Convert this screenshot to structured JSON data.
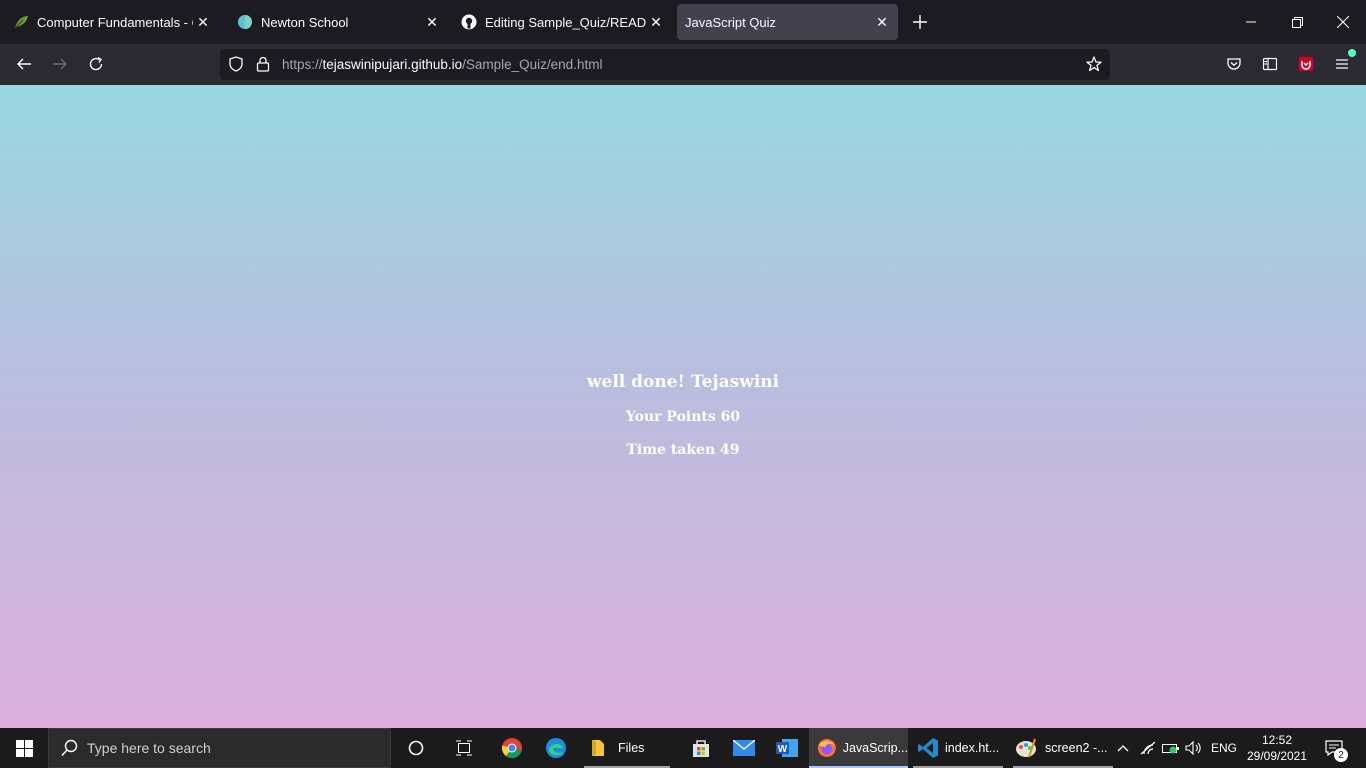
{
  "browser": {
    "tabs": [
      {
        "title": "Computer Fundamentals - Com",
        "icon": "leaf-icon"
      },
      {
        "title": "Newton School",
        "icon": "newton-icon"
      },
      {
        "title": "Editing Sample_Quiz/README.md",
        "icon": "github-icon"
      },
      {
        "title": "JavaScript Quiz",
        "icon": "none"
      }
    ],
    "url": {
      "prefix": "https://",
      "host": "tejaswinipujari.github.io",
      "path": "/Sample_Quiz/end.html"
    }
  },
  "page": {
    "heading": "well done! Tejaswini",
    "points": "Your Points 60",
    "time": "Time taken 49",
    "gradient_top": "#98d8e0",
    "gradient_bottom": "#dcb0dc"
  },
  "taskbar": {
    "search_placeholder": "Type here to search",
    "apps": [
      {
        "label": "Files"
      },
      {
        "label": "JavaScrip..."
      },
      {
        "label": "index.ht..."
      },
      {
        "label": "screen2 -..."
      }
    ],
    "language": "ENG",
    "time": "12:52",
    "date": "29/09/2021",
    "notification_count": "2"
  }
}
